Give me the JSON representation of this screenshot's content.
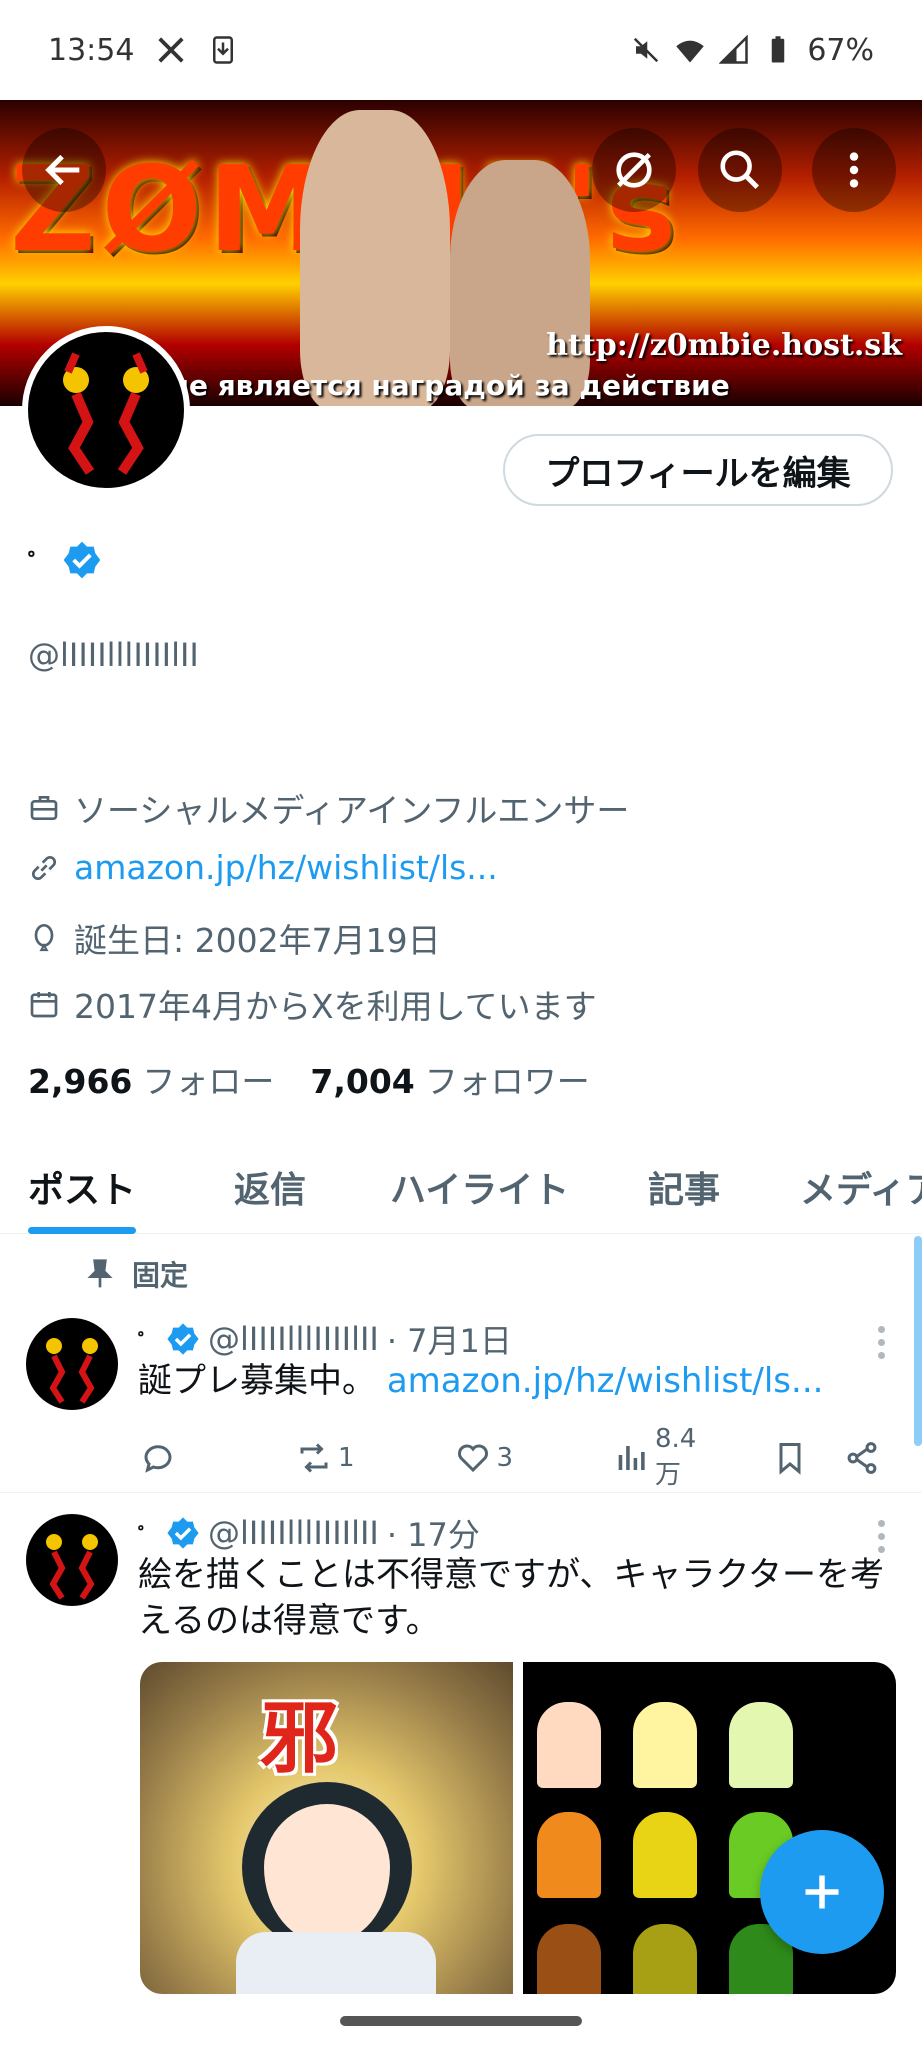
{
  "status_bar": {
    "time": "13:54",
    "battery": "67%"
  },
  "banner": {
    "title": "ZØMBIE's",
    "url": "http://z0mbie.host.sk",
    "caption": "ние является наградой за действие"
  },
  "profile": {
    "edit_button": "プロフィールを編集",
    "display_name": "゜",
    "handle": "@lIIIIlllIIIIlII",
    "job": "ソーシャルメディアインフルエンサー",
    "website": "amazon.jp/hz/wishlist/ls...",
    "birthday": "誕生日: 2002年7月19日",
    "joined": "2017年4月からXを利用しています",
    "following_count": "2,966",
    "following_label": "フォロー",
    "followers_count": "7,004",
    "followers_label": "フォロワー"
  },
  "tabs": [
    "ポスト",
    "返信",
    "ハイライト",
    "記事",
    "メディア"
  ],
  "posts": [
    {
      "pinned_label": "固定",
      "display_name": "゜",
      "handle": "@lIIIIlllIIIIlII",
      "time": "· 7月1日",
      "text": "誕プレ募集中。",
      "link": "amazon.jp/hz/wishlist/ls...",
      "replies": "",
      "reposts": "1",
      "likes": "3",
      "views": "8.4万"
    },
    {
      "display_name": "゜",
      "handle": "@lIIIIlllIIIIlII",
      "time": "· 17分",
      "text": "絵を描くことは不得意ですが、キャラクターを考えるのは得意です。",
      "media_kanji": "邪"
    }
  ],
  "colors": {
    "accent": "#1d9bf0",
    "text": "#0f1419",
    "muted": "#536471"
  }
}
